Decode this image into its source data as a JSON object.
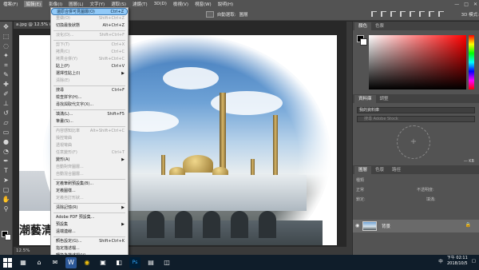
{
  "menubar": {
    "items": [
      "檔案(F)",
      "編輯(E)",
      "影像(I)",
      "圖層(L)",
      "文字(Y)",
      "選取(S)",
      "濾鏡(T)",
      "3D(D)",
      "檢視(V)",
      "視窗(W)",
      "說明(H)"
    ],
    "active_index": 1,
    "window_controls": [
      "—",
      "□",
      "✕"
    ]
  },
  "options_bar": {
    "auto_select_label": "自動選取:",
    "layer_label": "圖層",
    "mode_label": "3D 模式:"
  },
  "document": {
    "tab_title": "a.jpg @ 12.5% (背景, RGB/8)",
    "zoom_status": "12.5%",
    "watermark_text": "潮藝清真寺"
  },
  "dropdown": {
    "items": [
      {
        "label": "還原合併可見圖層(O)",
        "shortcut": "Ctrl+Z",
        "state": "highlighted"
      },
      {
        "label": "重做(O)",
        "shortcut": "Shift+Ctrl+Z",
        "state": "disabled"
      },
      {
        "label": "切換最後狀態",
        "shortcut": "Alt+Ctrl+Z",
        "state": "normal"
      },
      {
        "sep": true
      },
      {
        "label": "淡化(D)...",
        "shortcut": "Shift+Ctrl+F",
        "state": "disabled"
      },
      {
        "sep": true
      },
      {
        "label": "剪下(T)",
        "shortcut": "Ctrl+X",
        "state": "disabled"
      },
      {
        "label": "拷貝(C)",
        "shortcut": "Ctrl+C",
        "state": "disabled"
      },
      {
        "label": "拷貝合併(Y)",
        "shortcut": "Shift+Ctrl+C",
        "state": "disabled"
      },
      {
        "label": "貼上(P)",
        "shortcut": "Ctrl+V",
        "state": "normal"
      },
      {
        "label": "選擇性貼上(I)",
        "submenu": true,
        "state": "normal"
      },
      {
        "label": "清除(E)",
        "state": "disabled"
      },
      {
        "sep": true
      },
      {
        "label": "搜尋",
        "shortcut": "Ctrl+F",
        "state": "normal"
      },
      {
        "label": "檢查拼字(H)...",
        "state": "normal"
      },
      {
        "label": "尋找與取代文字(X)...",
        "state": "normal"
      },
      {
        "sep": true
      },
      {
        "label": "填滿(L)...",
        "shortcut": "Shift+F5",
        "state": "normal"
      },
      {
        "label": "筆畫(S)...",
        "state": "normal"
      },
      {
        "sep": true
      },
      {
        "label": "內容感知比率",
        "shortcut": "Alt+Shift+Ctrl+C",
        "state": "disabled"
      },
      {
        "label": "操控彎曲",
        "state": "disabled"
      },
      {
        "label": "透視彎曲",
        "state": "disabled"
      },
      {
        "label": "任意變形(F)",
        "shortcut": "Ctrl+T",
        "state": "disabled"
      },
      {
        "label": "變形(A)",
        "submenu": true,
        "state": "normal"
      },
      {
        "label": "自動對齊圖層...",
        "state": "disabled"
      },
      {
        "label": "自動混合圖層...",
        "state": "disabled"
      },
      {
        "sep": true
      },
      {
        "label": "定義筆刷預設集(B)...",
        "state": "normal"
      },
      {
        "label": "定義圖樣...",
        "state": "normal"
      },
      {
        "label": "定義自訂形狀...",
        "state": "disabled"
      },
      {
        "sep": true
      },
      {
        "label": "清除記憶(R)",
        "submenu": true,
        "state": "normal"
      },
      {
        "sep": true
      },
      {
        "label": "Adobe PDF 預設集...",
        "state": "normal"
      },
      {
        "label": "預設集",
        "submenu": true,
        "state": "normal"
      },
      {
        "label": "遠端連線...",
        "state": "normal"
      },
      {
        "sep": true
      },
      {
        "label": "顏色設定(G)...",
        "shortcut": "Shift+Ctrl+K",
        "state": "normal"
      },
      {
        "label": "指定描述檔...",
        "state": "normal"
      },
      {
        "label": "轉換為描述檔(V)...",
        "state": "normal"
      }
    ],
    "more_arrow": "▾"
  },
  "panels": {
    "color_tabs": [
      "顏色",
      "色票"
    ],
    "library_tabs": [
      "資料庫",
      "調整"
    ],
    "library_select": "我的資料庫",
    "library_search_placeholder": "搜尋 Adobe Stock",
    "library_kb": "— KB",
    "layer_tabs": [
      "圖層",
      "色版",
      "路徑"
    ],
    "layer_kind": "種類",
    "layer_blend": "正常",
    "layer_opacity": "不透明度:",
    "layer_lock": "鎖定:",
    "layer_fill": "填滿:",
    "layer_name": "背景",
    "footer_icons": [
      "⊖",
      "fx",
      "◐",
      "▢",
      "▤",
      "🗑"
    ]
  },
  "taskbar": {
    "apps": [
      "▦",
      "⌂",
      "✉",
      "W",
      "◉",
      "▣",
      "◧",
      "Ps",
      "▤",
      "◫"
    ],
    "time": "下午 02:11",
    "date": "2018/10/5",
    "ime": "中"
  }
}
